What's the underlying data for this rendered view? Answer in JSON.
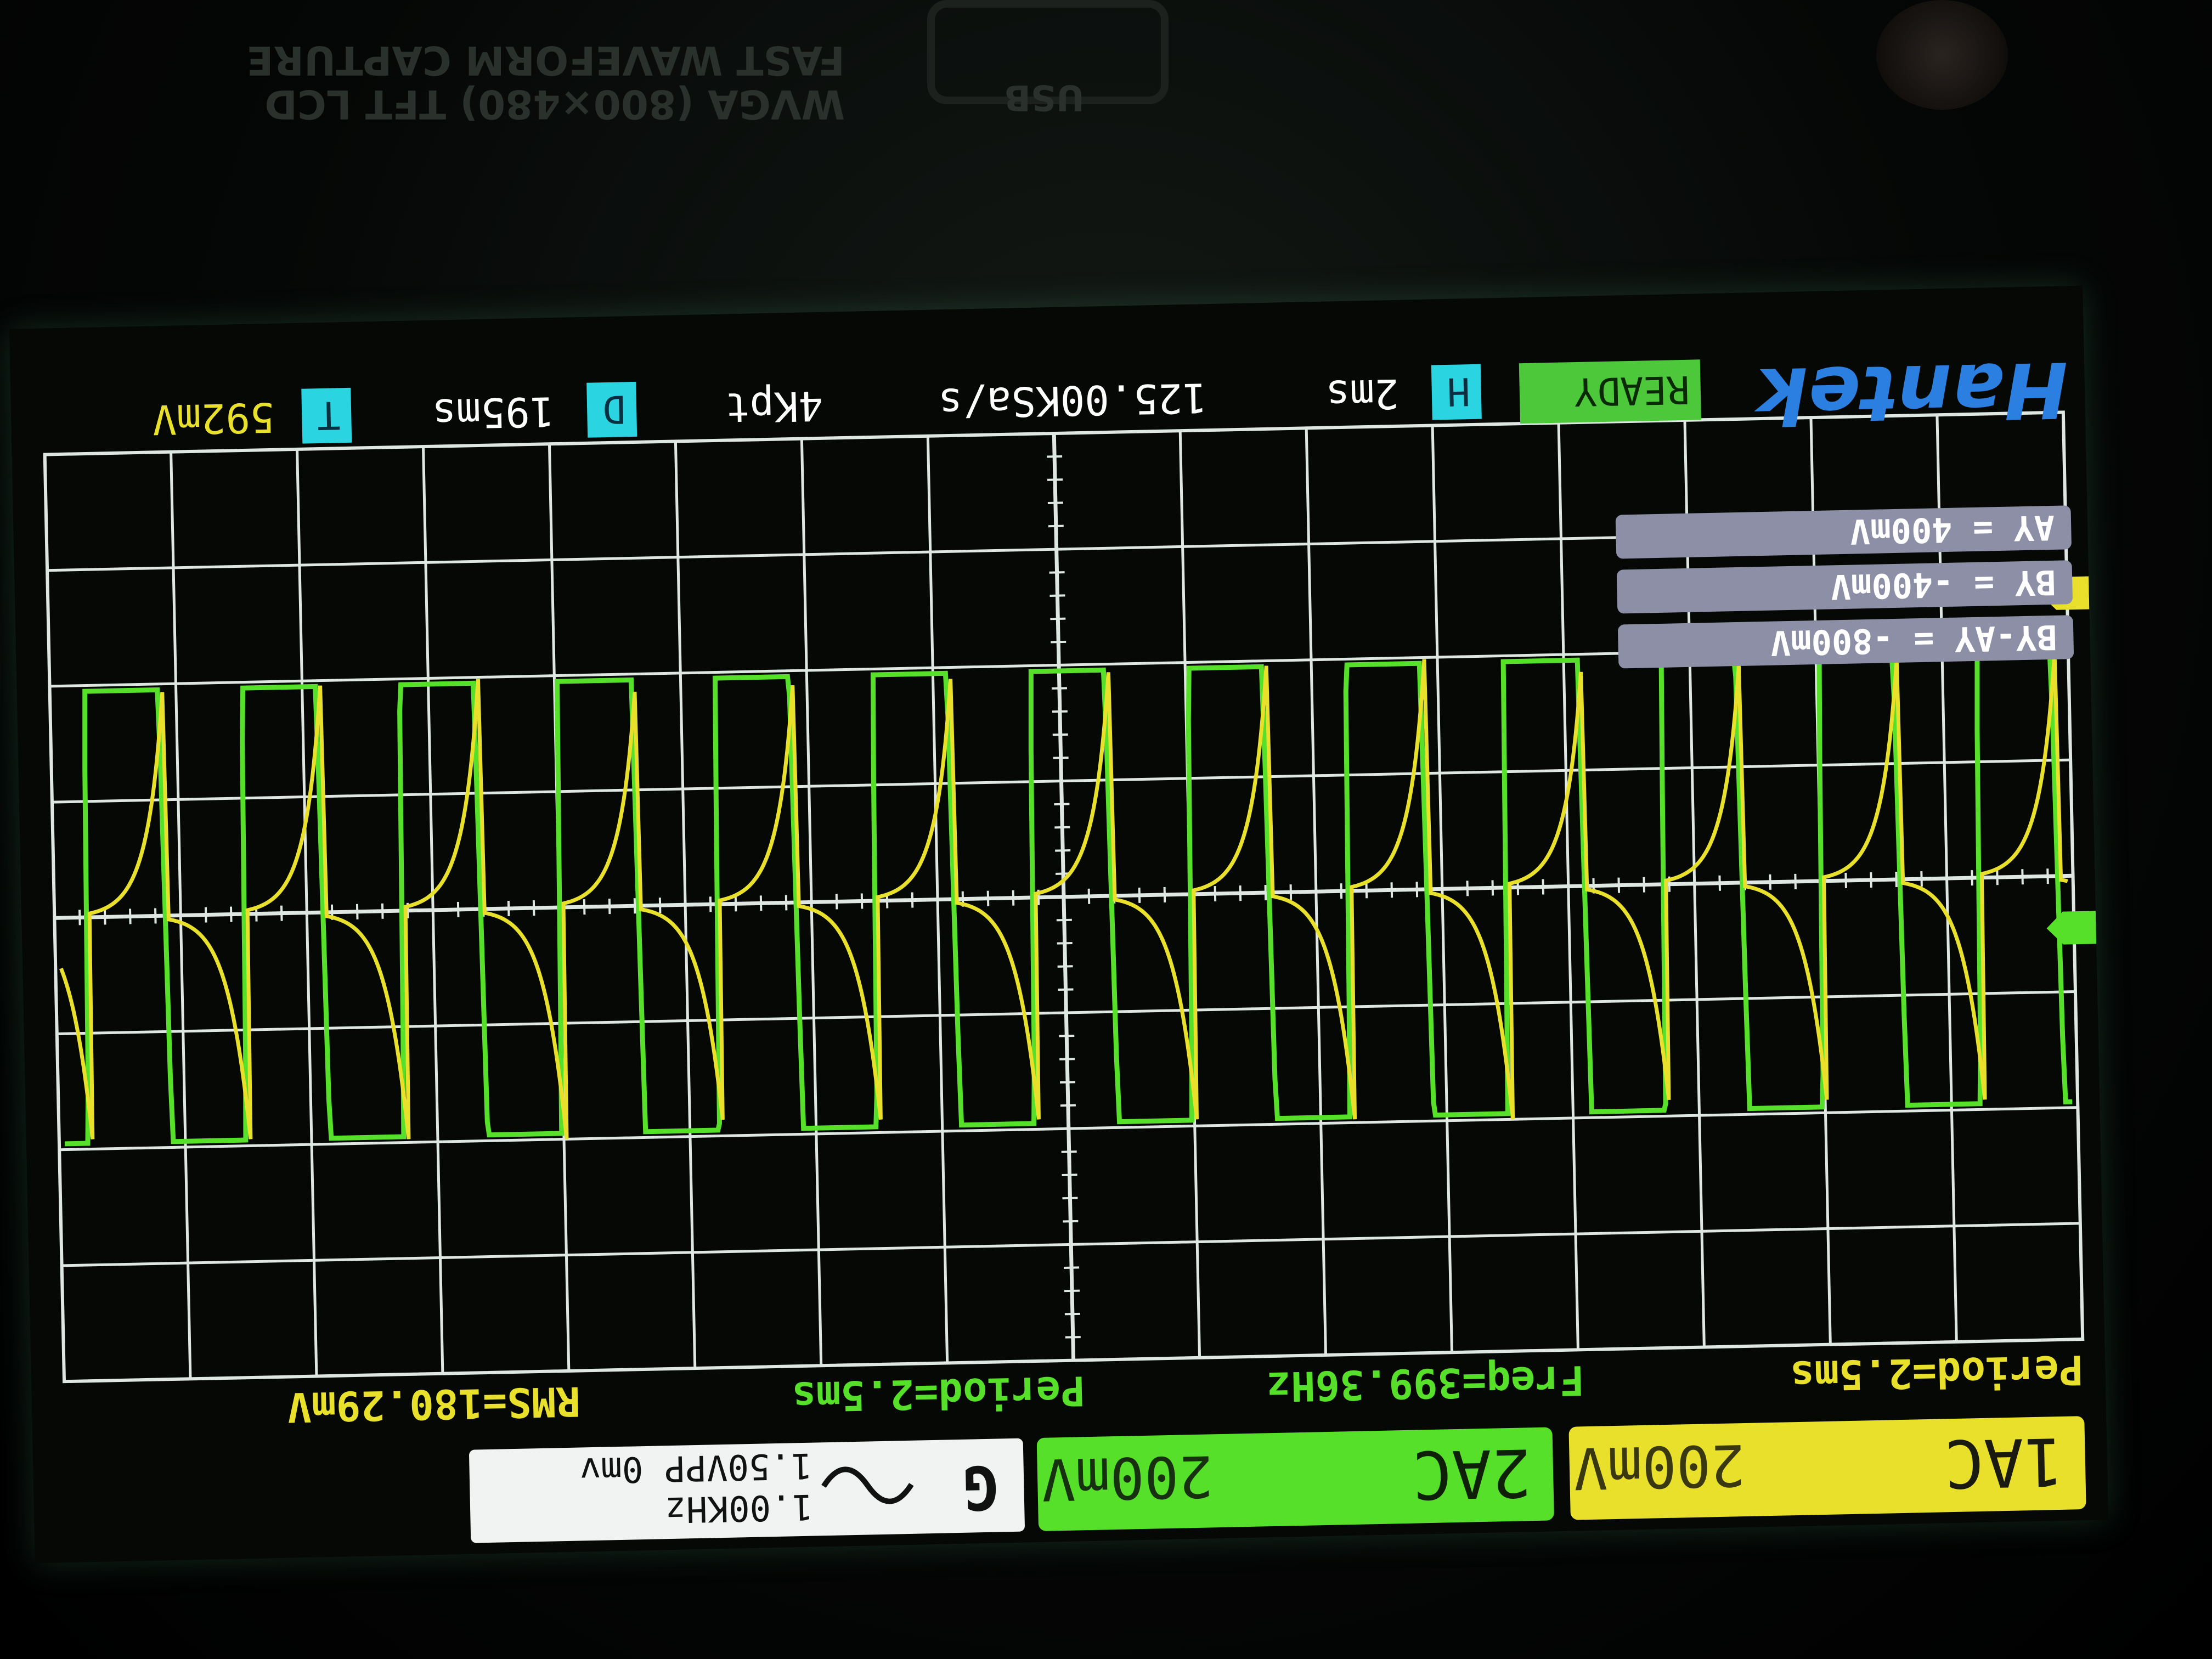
{
  "bezel": {
    "capture_text": "FAST WAVEFORM CAPTURE",
    "lcd_text": "WVGA (800×480) TFT LCD",
    "usb_label": "USB"
  },
  "header": {
    "ch1": {
      "label": "1AC",
      "scale": "200mV",
      "color": "#e8e02a"
    },
    "ch2": {
      "label": "2AC",
      "scale": "200mV",
      "color": "#57e02a"
    },
    "generator": {
      "label": "G",
      "freq": "1.00KHz",
      "amplitude": "1.50VPP 0mv"
    }
  },
  "measurements": {
    "ch1_period": "Period=2.5ms",
    "ch2_freq": "Freq=399.36Hz",
    "ch2_period": "Period=2.5ms",
    "ch1_rms": "RMS=180.29mV"
  },
  "cursors": {
    "ay": "AY   = 400mV",
    "by": "BY   = -400mV",
    "delta": "BY-AY = -800mV"
  },
  "footer": {
    "brand": "Hantek",
    "status": "READY",
    "h_label": "H",
    "timebase": "2ms",
    "sample_rate": "125.00KSa/s",
    "memory": "4Kpt",
    "d_label": "D",
    "delay": "195ms",
    "t_label": "T",
    "trigger_level": "592mV"
  },
  "colors": {
    "ch1": "#e8e02a",
    "ch2": "#57e02a",
    "grid": "#dfe7e2",
    "screen_bg": "#050805",
    "cyan_badge": "#2ad4e0"
  },
  "waveform": {
    "period_ms": 2.5,
    "timebase_ms_per_div": 2,
    "vertical_scale_mv_per_div": 200,
    "ch2_amplitude_mv": 800
  }
}
